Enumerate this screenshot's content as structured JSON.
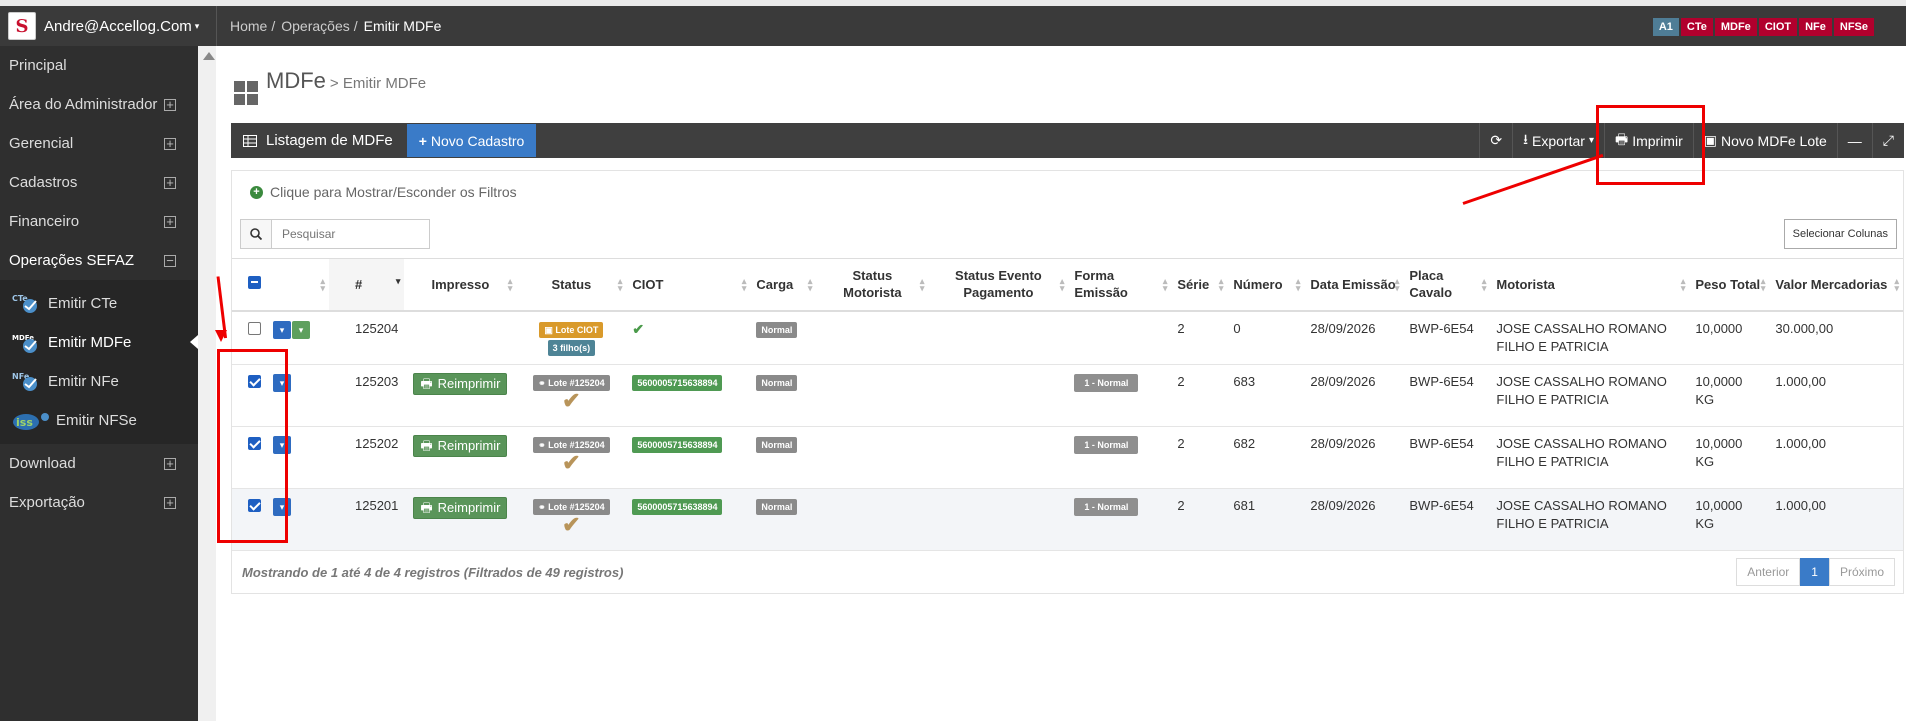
{
  "topbar": {
    "user": "Andre@Accellog.Com",
    "breadcrumb": [
      "Home",
      "Operações",
      "Emitir MDFe"
    ],
    "badges": [
      {
        "label": "A1",
        "color": "#4f7d96"
      },
      {
        "label": "CTe",
        "color": "#b1002d"
      },
      {
        "label": "MDFe",
        "color": "#b1002d"
      },
      {
        "label": "CIOT",
        "color": "#b1002d"
      },
      {
        "label": "NFe",
        "color": "#b1002d"
      },
      {
        "label": "NFSe",
        "color": "#b1002d"
      }
    ]
  },
  "sidebar": {
    "items": [
      {
        "label": "Principal"
      },
      {
        "label": "Área do Administrador"
      },
      {
        "label": "Gerencial"
      },
      {
        "label": "Cadastros"
      },
      {
        "label": "Financeiro"
      },
      {
        "label": "Operações SEFAZ"
      }
    ],
    "sub": [
      {
        "label": "Emitir CTe",
        "icon": "cte-icon"
      },
      {
        "label": "Emitir MDFe",
        "icon": "mdfe-icon"
      },
      {
        "label": "Emitir NFe",
        "icon": "nfe-icon"
      },
      {
        "label": "Emitir NFSe",
        "icon": "nfse-icon"
      }
    ],
    "after": [
      {
        "label": "Download"
      },
      {
        "label": "Exportação"
      }
    ]
  },
  "page": {
    "title": "MDFe",
    "subtitle": "> Emitir MDFe"
  },
  "toolbar": {
    "list_title": "Listagem de MDFe",
    "new_button": "Novo Cadastro",
    "export": "Exportar",
    "print": "Imprimir",
    "new_lote": "Novo MDFe Lote"
  },
  "filters": {
    "toggle": "Clique para Mostrar/Esconder os Filtros",
    "search_placeholder": "Pesquisar",
    "select_columns": "Selecionar Colunas"
  },
  "table": {
    "headers": [
      "#",
      "Impresso",
      "Status",
      "CIOT",
      "Carga",
      "Status Motorista",
      "Status Evento Pagamento",
      "Forma Emissão",
      "Série",
      "Número",
      "Data Emissão",
      "Placa Cavalo",
      "Motorista",
      "Peso Total",
      "Valor Mercadorias"
    ],
    "rows": [
      {
        "checked": false,
        "id": "125204",
        "impresso": "",
        "status": "Lote CIOT",
        "status2": "3 filho(s)",
        "ciot": "✔",
        "carga": "Normal",
        "forma": "",
        "serie": "2",
        "numero": "0",
        "data": "28/09/2026",
        "placa": "BWP-6E54",
        "motorista": "JOSE CASSALHO ROMANO FILHO E PATRICIA",
        "peso": "10,0000",
        "valor": "30.000,00"
      },
      {
        "checked": true,
        "id": "125203",
        "impresso": "Reimprimir",
        "status": "Lote #125204",
        "ciot": "5600005715638894",
        "carga": "Normal",
        "forma": "1 - Normal",
        "serie": "2",
        "numero": "683",
        "data": "28/09/2026",
        "placa": "BWP-6E54",
        "motorista": "JOSE CASSALHO ROMANO FILHO E PATRICIA",
        "peso": "10,0000 KG",
        "valor": "1.000,00"
      },
      {
        "checked": true,
        "id": "125202",
        "impresso": "Reimprimir",
        "status": "Lote #125204",
        "ciot": "5600005715638894",
        "carga": "Normal",
        "forma": "1 - Normal",
        "serie": "2",
        "numero": "682",
        "data": "28/09/2026",
        "placa": "BWP-6E54",
        "motorista": "JOSE CASSALHO ROMANO FILHO E PATRICIA",
        "peso": "10,0000 KG",
        "valor": "1.000,00"
      },
      {
        "checked": true,
        "id": "125201",
        "impresso": "Reimprimir",
        "status": "Lote #125204",
        "ciot": "5600005715638894",
        "carga": "Normal",
        "forma": "1 - Normal",
        "serie": "2",
        "numero": "681",
        "data": "28/09/2026",
        "placa": "BWP-6E54",
        "motorista": "JOSE CASSALHO ROMANO FILHO E PATRICIA",
        "peso": "10,0000 KG",
        "valor": "1.000,00"
      }
    ]
  },
  "footer": {
    "info": "Mostrando de 1 até 4 de 4 registros (Filtrados de 49 registros)",
    "prev": "Anterior",
    "page": "1",
    "next": "Próximo"
  },
  "annotation_color": "#e00000"
}
